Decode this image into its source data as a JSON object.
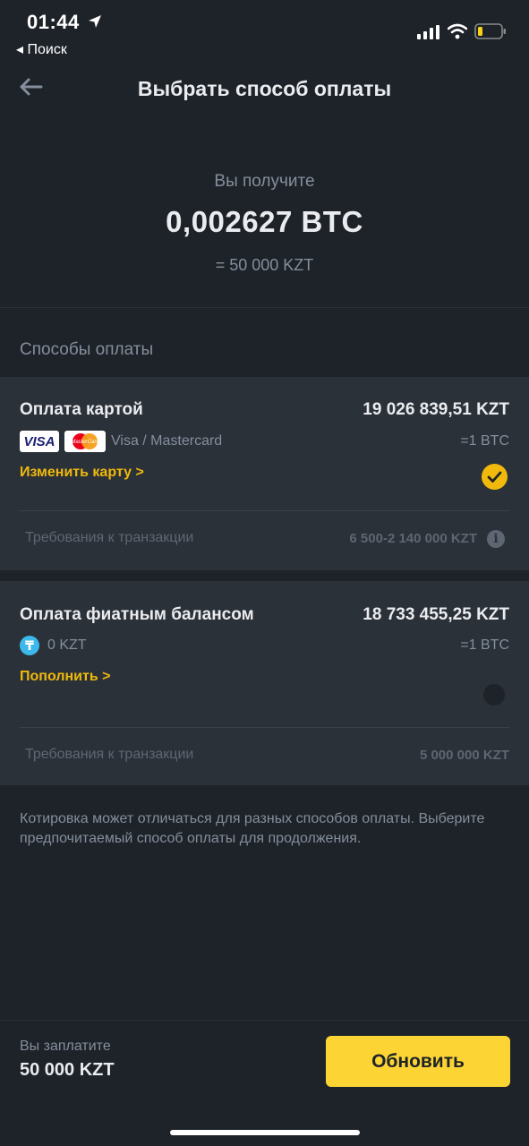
{
  "status_bar": {
    "time": "01:44",
    "back_app": "◂ Поиск"
  },
  "header": {
    "title": "Выбрать способ оплаты"
  },
  "receive": {
    "label": "Вы получите",
    "amount": "0,002627 BTC",
    "fiat_equivalent": "= 50 000 KZT"
  },
  "payment_methods": {
    "section_title": "Способы оплаты",
    "items": [
      {
        "title": "Оплата картой",
        "price": "19 026 839,51 KZT",
        "subtitle": "Visa / Mastercard",
        "rate": "=1 BTC",
        "action": "Изменить карту >",
        "requirements_label": "Требования к транзакции",
        "requirements_value": "6 500-2 140 000 KZT",
        "selected": true,
        "logos": [
          "visa-logo",
          "mastercard-logo"
        ]
      },
      {
        "title": "Оплата фиатным балансом",
        "price": "18 733 455,25 KZT",
        "subtitle": "0 KZT",
        "rate": "=1 BTC",
        "action": "Пополнить >",
        "requirements_label": "Требования к транзакции",
        "requirements_value": "5 000 000 KZT",
        "selected": false,
        "icon": "tenge-icon"
      }
    ]
  },
  "note": "Котировка может отличаться для разных способов оплаты. Выберите предпочитаемый способ оплаты для продолжения.",
  "footer": {
    "pay_label": "Вы заплатите",
    "pay_amount": "50 000 KZT",
    "refresh_label": "Обновить"
  },
  "logos": {
    "visa_text": "VISA",
    "mastercard_text": "MasterCard"
  },
  "colors": {
    "background": "#1e2329",
    "card": "#2b3139",
    "accent": "#f0b90b",
    "button": "#fcd535",
    "muted_text": "#848e9c",
    "tenge_icon": "#3cb8ec"
  }
}
